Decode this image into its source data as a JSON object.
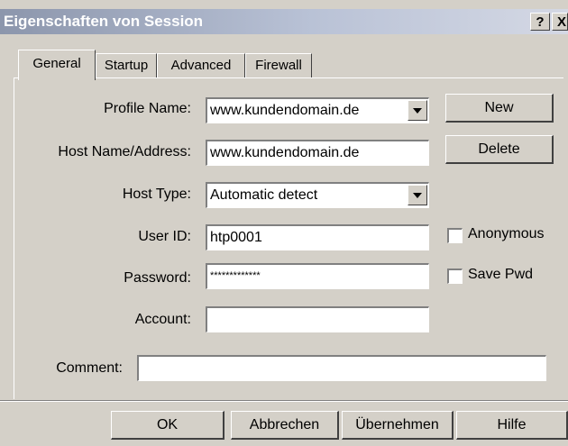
{
  "window": {
    "title": "Eigenschaften von Session",
    "help_label": "?",
    "close_label": "X"
  },
  "tabs": [
    {
      "label": "General",
      "active": true
    },
    {
      "label": "Startup",
      "active": false
    },
    {
      "label": "Advanced",
      "active": false
    },
    {
      "label": "Firewall",
      "active": false
    }
  ],
  "form": {
    "profile_name_label": "Profile Name:",
    "profile_name_value": "www.kundendomain.de",
    "host_label": "Host Name/Address:",
    "host_value": "www.kundendomain.de",
    "host_type_label": "Host Type:",
    "host_type_value": "Automatic detect",
    "user_id_label": "User ID:",
    "user_id_value": "htp0001",
    "password_label": "Password:",
    "password_value": "*************",
    "account_label": "Account:",
    "account_value": "",
    "comment_label": "Comment:",
    "comment_value": "",
    "anonymous_label": "Anonymous",
    "anonymous_checked": false,
    "save_pwd_label": "Save Pwd",
    "save_pwd_checked": false,
    "new_label": "New",
    "delete_label": "Delete"
  },
  "footer": {
    "ok_label": "OK",
    "cancel_label": "Abbrechen",
    "apply_label": "Übernehmen",
    "help_label": "Hilfe"
  }
}
